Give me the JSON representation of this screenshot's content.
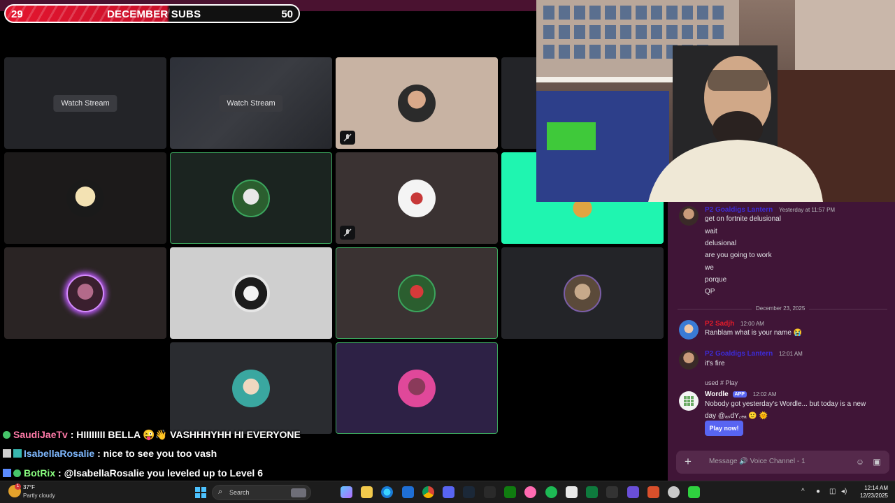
{
  "overlay": {
    "subs_goal": {
      "current": "29",
      "title": "DECEMBER SUBS",
      "target": "50"
    }
  },
  "tiles": {
    "watch_stream_label": "Watch Stream"
  },
  "discord_chat": {
    "messages": [
      {
        "name": "P2 Goaldigs Lantern",
        "time": "Yesterday at 11:57 PM",
        "name_color": "#3d2bd6",
        "lines": [
          "get on fortnite delusional",
          "wait",
          "delusional",
          "are you going to work",
          "we",
          "porque",
          "QP"
        ]
      },
      {
        "name": "P2 Sadjh",
        "time": "12:00 AM",
        "name_color": "#e21b2a",
        "lines": [
          "Ranblam what is your name 😭"
        ]
      },
      {
        "name": "P2 Goaldigs Lantern",
        "time": "12:01 AM",
        "name_color": "#3d2bd6",
        "lines": [
          "it's fire"
        ]
      },
      {
        "name": "Wordle",
        "app_badge": "APP",
        "time": "12:02 AM",
        "name_color": "#ffffff",
        "reply": "used # Play",
        "lines": [
          "Nobody got yesterday's Wordle... but today is a new",
          "day @ₐₛdY꜀ₑₐ 🙂 🌞"
        ]
      }
    ],
    "date_divider": "December 23, 2025",
    "play_button": "Play now!",
    "input_placeholder": "Message 🔊 Voice Channel - 1"
  },
  "twitch_chat": [
    {
      "user": "SaudiJaeTv",
      "message": ": HIIIIIIII BELLA 😜👋  VASHHHYHH HI EVERYONE"
    },
    {
      "user": "IsabellaRosalie",
      "message": ": nice to see you too vash"
    },
    {
      "user": "BotRix",
      "message": ": @IsabellaRosalie you leveled up to Level 6"
    }
  ],
  "taskbar": {
    "temperature": "37°F",
    "condition": "Partly cloudy",
    "weather_badge": "1",
    "search_label": "Search",
    "time": "12:14 AM",
    "date": "12/23/2025"
  },
  "colors": {
    "speaking_border": "#3ba55d",
    "discord_bg": "#401537",
    "blurple": "#5865f2"
  }
}
